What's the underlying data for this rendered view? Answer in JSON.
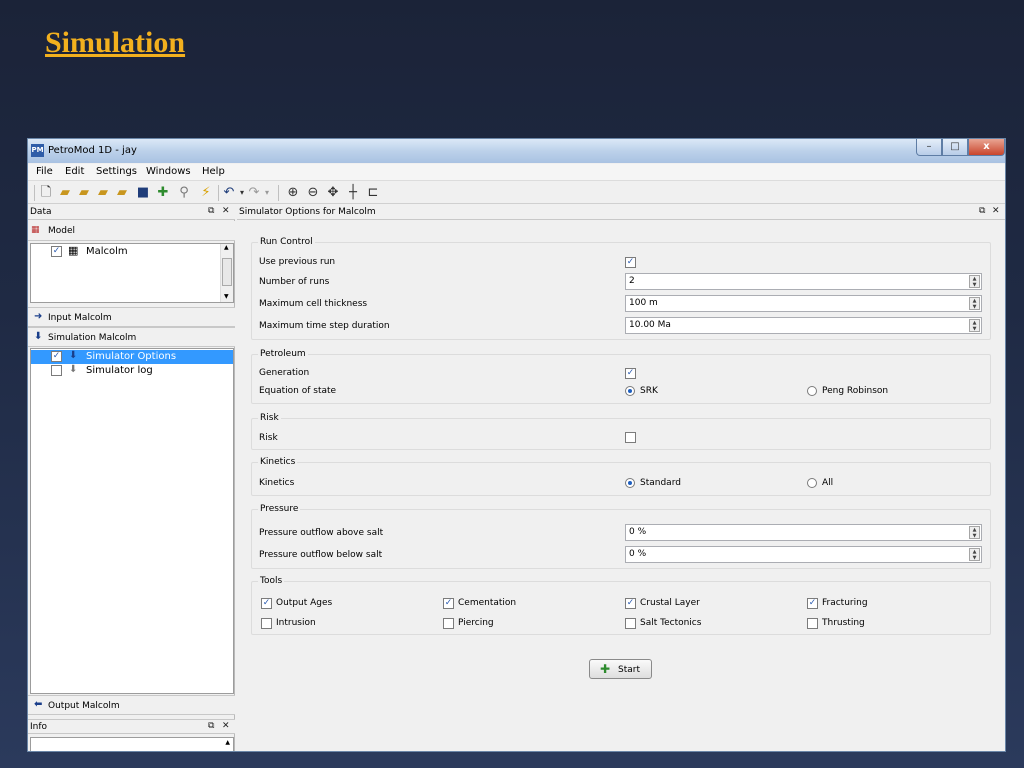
{
  "slide": {
    "title": "Simulation"
  },
  "window": {
    "title": "PetroMod 1D - jay",
    "controls": {
      "minimize": "–",
      "maximize": "□",
      "close": "x"
    }
  },
  "menubar": [
    "File",
    "Edit",
    "Settings",
    "Windows",
    "Help"
  ],
  "toolbar_icons": [
    "new-icon",
    "open-icon",
    "open-folder-icon",
    "open-multi-icon",
    "open-edit-icon",
    "save-icon",
    "simulate-icon",
    "run-icon",
    "light-icon",
    "undo-icon",
    "redo-icon",
    "zoom-in-icon",
    "zoom-out-icon",
    "pan-icon",
    "crosshair-icon",
    "ruler-icon"
  ],
  "data_panel": {
    "title": "Data",
    "model_label": "Model",
    "model_items": [
      {
        "label": "Malcolm",
        "checked": true
      }
    ],
    "input_label": "Input Malcolm",
    "simulation_label": "Simulation Malcolm",
    "simulation_items": [
      {
        "label": "Simulator Options",
        "checked": true,
        "selected": true
      },
      {
        "label": "Simulator log",
        "checked": false,
        "selected": false
      }
    ],
    "output_label": "Output Malcolm"
  },
  "info_panel": {
    "title": "Info"
  },
  "main": {
    "title": "Simulator Options for Malcolm",
    "run_control": {
      "title": "Run Control",
      "use_previous_run_label": "Use previous run",
      "use_previous_run": true,
      "number_of_runs_label": "Number of runs",
      "number_of_runs": "2",
      "max_cell_thickness_label": "Maximum cell thickness",
      "max_cell_thickness": "100 m",
      "max_time_step_label": "Maximum time step duration",
      "max_time_step": "10.00 Ma"
    },
    "petroleum": {
      "title": "Petroleum",
      "generation_label": "Generation",
      "generation": true,
      "eos_label": "Equation of state",
      "eos_options": [
        "SRK",
        "Peng Robinson"
      ],
      "eos_selected": "SRK"
    },
    "risk": {
      "title": "Risk",
      "risk_label": "Risk",
      "risk": false
    },
    "kinetics": {
      "title": "Kinetics",
      "kinetics_label": "Kinetics",
      "options": [
        "Standard",
        "All"
      ],
      "selected": "Standard"
    },
    "pressure": {
      "title": "Pressure",
      "above_salt_label": "Pressure outflow above salt",
      "above_salt": "0 %",
      "below_salt_label": "Pressure outflow below salt",
      "below_salt": "0 %"
    },
    "tools": {
      "title": "Tools",
      "items": [
        {
          "label": "Output Ages",
          "checked": true
        },
        {
          "label": "Cementation",
          "checked": true
        },
        {
          "label": "Crustal Layer",
          "checked": true
        },
        {
          "label": "Fracturing",
          "checked": true
        },
        {
          "label": "Intrusion",
          "checked": false
        },
        {
          "label": "Piercing",
          "checked": false
        },
        {
          "label": "Salt Tectonics",
          "checked": false
        },
        {
          "label": "Thrusting",
          "checked": false
        }
      ]
    },
    "start_label": "Start"
  }
}
